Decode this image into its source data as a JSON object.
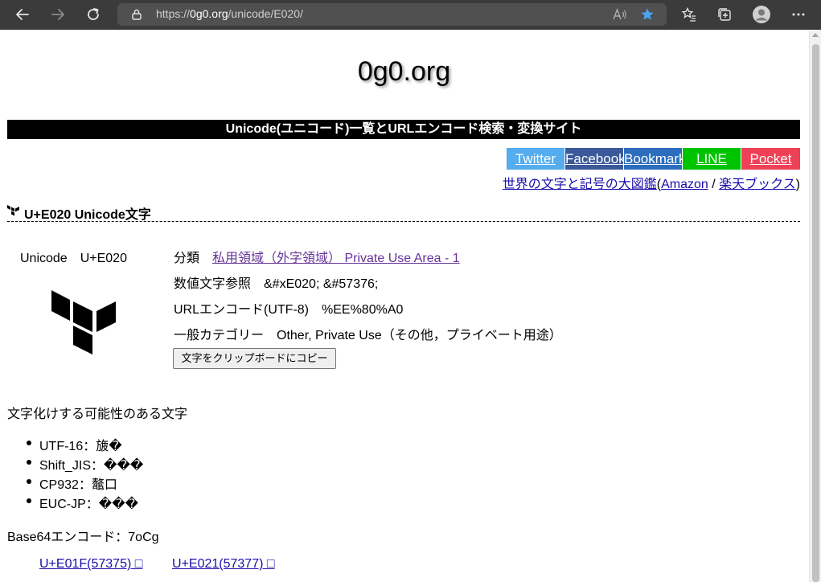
{
  "browser": {
    "url_prefix": "https://",
    "url_host": "0g0.org",
    "url_path": "/unicode/E020/"
  },
  "site": {
    "title": "0g0.org",
    "banner": "Unicode(ユニコード)一覧とURLエンコード検索・変換サイト"
  },
  "share": {
    "twitter": "Twitter",
    "facebook": "Facebook",
    "bookmark": "Bookmark",
    "line": "LINE",
    "pocket": "Pocket"
  },
  "book": {
    "title": "世界の文字と記号の大図鑑",
    "open_paren": "(",
    "amazon": "Amazon",
    "sep": " / ",
    "rakuten": "楽天ブックス",
    "close_paren": ")"
  },
  "char": {
    "heading": "U+E020 Unicode文字",
    "code_label": "Unicode　U+E020",
    "category_label": "分類　",
    "category_link": "私用領域（外字領域） Private Use Area - 1",
    "numref": "数値文字参照　&#xE020; &#57376;",
    "urlencode": "URLエンコード(UTF-8)　%EE%80%A0",
    "general_category": "一般カテゴリー　Other, Private Use（その他，プライベート用途）",
    "copy_button": "文字をクリップボードにコピー"
  },
  "garble": {
    "title": "文字化けする可能性のある文字",
    "items": [
      "UTF-16：旇�",
      "Shift_JIS：���",
      "CP932：鼇口",
      "EUC-JP：���"
    ]
  },
  "base64": "Base64エンコード：7oCg",
  "nav": {
    "prev": "U+E01F(57375) □",
    "next": "U+E021(57377) □"
  },
  "colors": {
    "twitter": "#55acee",
    "facebook": "#3b5998",
    "bookmark": "#2c6ebd",
    "line": "#00c300",
    "pocket": "#ee4056",
    "link": "#1a0dab",
    "visited_link": "#663399"
  }
}
